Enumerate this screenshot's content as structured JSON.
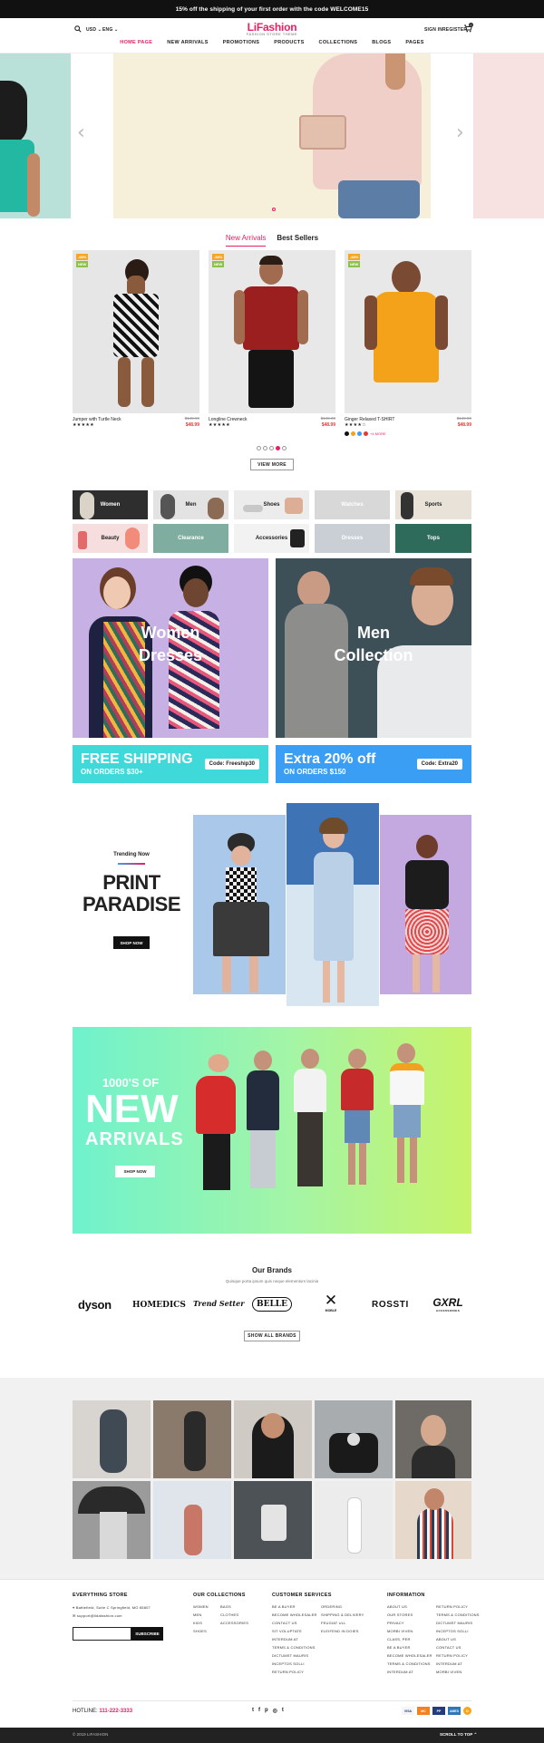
{
  "topbar": {
    "text": "15% off the shipping of your first order with the code WELCOME15"
  },
  "header": {
    "currency": "USD",
    "language": "ENG",
    "logo": "LiFashion",
    "tagline": "FASHION STORE THEME",
    "sign_in": "SIGN IN",
    "register": "REGISTER",
    "cart_count": "0"
  },
  "nav": [
    "HOME PAGE",
    "NEW ARRIVALS",
    "PROMOTIONS",
    "PRODUCTS",
    "COLLECTIONS",
    "BLOGS",
    "PAGES"
  ],
  "tabs": {
    "new_arrivals": "New Arrivals",
    "best_sellers": "Best Sellers"
  },
  "products": [
    {
      "name": "Jumper with Turtle Neck",
      "old_price": "$149.99",
      "price": "$48.99",
      "badge_top": "-68%",
      "badge_bottom": "NEW",
      "stars": "★★★★★"
    },
    {
      "name": "Longline Crewneck",
      "old_price": "$149.99",
      "price": "$48.99",
      "badge_top": "-68%",
      "badge_bottom": "NEW",
      "stars": "★★★★★"
    },
    {
      "name": "Ginger Relaxed T-SHIRT",
      "old_price": "$149.99",
      "price": "$48.99",
      "badge_top": "-68%",
      "badge_bottom": "NEW",
      "stars": "★★★★☆",
      "swatch_more": "+4 MORE"
    }
  ],
  "view_more": "VIEW MORE",
  "categories": [
    "Women",
    "Men",
    "Shoes",
    "Watches",
    "Sports",
    "Beauty",
    "Clearance",
    "Accessories",
    "Dresses",
    "Tops"
  ],
  "banners": {
    "women": "Women\nDresses",
    "men": "Men\nCollection"
  },
  "promos": [
    {
      "title": "FREE SHIPPING",
      "subtitle": "ON ORDERS $30+",
      "code": "Code: Freeship30"
    },
    {
      "title": "Extra 20% off",
      "subtitle": "ON ORDERS $150",
      "code": "Code: Extra20"
    }
  ],
  "trending": {
    "eyebrow": "Trending Now",
    "title": "PRINT\nPARADISE",
    "button": "SHOP NOW"
  },
  "arrivals_banner": {
    "line1": "1000'S OF",
    "line2": "NEW",
    "line3": "ARRIVALS",
    "button": "SHOP NOW"
  },
  "brands": {
    "title": "Our Brands",
    "subtitle": "Quisque porta ipsum quis neque elementum lacinia",
    "items": [
      "dyson",
      "HOMEDICS",
      "Trend Setter",
      "BELLE",
      "MOBLE",
      "ROSSTI",
      "GXRL"
    ],
    "sub_items": [
      "",
      "",
      "",
      "",
      "",
      "",
      "ACCESSORIES"
    ],
    "button": "SHOW ALL BRANDS"
  },
  "footer": {
    "store_title": "EVERYTHING STORE",
    "address": "Battlefield, Suite C Springfield, MO 65807",
    "email": "support@lidafashion.com",
    "subscribe": "SUBSCRIBE",
    "collections_title": "OUR COLLECTIONS",
    "collections_col1": [
      "WOMEN",
      "MEN",
      "KIDS",
      "SHOES"
    ],
    "collections_col2": [
      "BAGS",
      "CLOTHES",
      "ACCESSORIES"
    ],
    "service_title": "CUSTOMER SERVICES",
    "service_col1": [
      "BE A BUYER",
      "BECOME WHOLESALER",
      "CONTACT US",
      "SIT VOLUPTATE",
      "INTERDUM AT",
      "TERMS & CONDITIONS",
      "DICTUMST MAURIS",
      "INCEPTOS SOLLI",
      "RETURN POLICY"
    ],
    "service_col2": [
      "ORDERING",
      "SHIPPING & DELIVERY",
      "FEUGIAT ULL",
      "ELEIFEND IN DOIES"
    ],
    "info_title": "INFORMATION",
    "info_col1": [
      "ABOUT US",
      "OUR STORES",
      "PRIVACY",
      "MORBI VIVEN",
      "CLASS, PER",
      "BE A BUYER",
      "BECOME WHOLESALER",
      "TERMS & CONDITIONS",
      "INTERDUM AT"
    ],
    "info_col2": [
      "RETURN POLICY",
      "TERMS & CONDITIONS",
      "DICTUMST MAURIS",
      "INCEPTOS SOLLI",
      "ABOUT US",
      "CONTACT US",
      "RETURN POLICY",
      "INTERDUM AT",
      "MORBI VIVEN"
    ],
    "hotline_label": "HOTLINE:",
    "hotline": "111-222-3333",
    "payments": [
      "VISA",
      "MC",
      "PP",
      "AMEX",
      "D"
    ],
    "copyright": "© 2019 LIFASHION",
    "scroll_top": "SCROLL TO TOP"
  },
  "colors": {
    "accent": "#e91e63",
    "topbar": "#111111",
    "promo1": "#3fd9d9",
    "promo2": "#3a9ef5",
    "banner_women": "#c7b0e3",
    "banner_men": "#3d4f57"
  }
}
